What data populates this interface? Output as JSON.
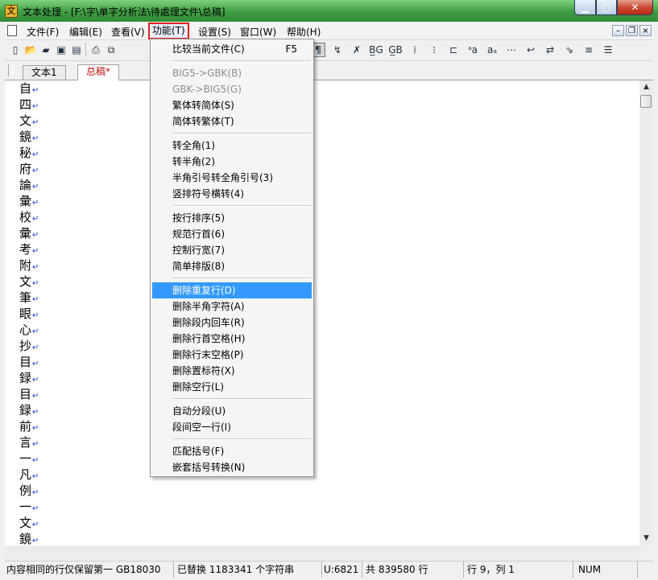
{
  "window": {
    "title": "文本处理 - [F:\\字\\单字分析法\\待處理文件\\总稿]",
    "icon": "app-icon",
    "min_glyph": "▁",
    "max_glyph": "▢",
    "close_glyph": "✕"
  },
  "menubar": {
    "items": [
      "文件(F)",
      "编辑(E)",
      "查看(V)",
      "功能(T)",
      "设置(S)",
      "窗口(W)",
      "帮助(H)"
    ],
    "active_index": 3,
    "mdi_min": "–",
    "mdi_restore": "❐",
    "mdi_close": "×"
  },
  "toolbar": {
    "left_icons": [
      "new-icon",
      "open-icon",
      "open-folder-icon",
      "save-icon",
      "save-all-icon",
      "print-icon",
      "copy-icon"
    ],
    "left_glyphs": [
      "▯",
      "📂",
      "▰",
      "▣",
      "▤",
      "⎙",
      "⧉"
    ],
    "right_icons": [
      "paragraph-icon",
      "wrap-icon",
      "clear-icon",
      "big5-gbk-icon",
      "gbk-big5-icon",
      "fullwidth-icon",
      "halfwidth-icon",
      "indent-icon",
      "case-up-icon",
      "case-down-icon",
      "grid-icon",
      "return-icon",
      "swap-icon",
      "sort-icon",
      "color-lines-icon",
      "align-icon"
    ],
    "right_glyphs": [
      "¶",
      "↯",
      "✗",
      "B̲G",
      "G̲B",
      "⁞",
      "⁝",
      "⊏",
      "ᵃa",
      "aₐ",
      "⋯",
      "↩",
      "⇄",
      "⇘",
      "≡",
      "☰"
    ]
  },
  "tabs": [
    {
      "label": "文本1",
      "active": false
    },
    {
      "label": "总稿*",
      "active": true
    }
  ],
  "editor": {
    "lines": [
      "自",
      "四",
      "文",
      "鏡",
      "秘",
      "府",
      "論",
      "彙",
      "校",
      "彙",
      "考",
      "附",
      "文",
      "筆",
      "眼",
      "心",
      "抄",
      "目",
      "録",
      "目",
      "録",
      "前",
      "言",
      "一",
      "凡",
      "例",
      "一",
      "文",
      "鏡"
    ],
    "return_mark": "↵"
  },
  "scroll": {
    "up": "▲",
    "down": "▼"
  },
  "statusbar": {
    "message": "内容相同的行仅保留第一",
    "encoding": "GB18030",
    "replaced": "已替换 1183341 个字符串",
    "unicode": "U:6821",
    "total_lines": "共 839580 行",
    "position": "行 9，列 1",
    "num": "NUM"
  },
  "dropdown": {
    "groups": [
      [
        {
          "label": "比较当前文件(C)",
          "shortcut": "F5"
        }
      ],
      [
        {
          "label": "BIG5->GBK(B)",
          "disabled": true
        },
        {
          "label": "GBK->BIG5(G)",
          "disabled": true
        },
        {
          "label": "繁体转简体(S)"
        },
        {
          "label": "简体转繁体(T)"
        }
      ],
      [
        {
          "label": "转全角(1)"
        },
        {
          "label": "转半角(2)"
        },
        {
          "label": "半角引号转全角引号(3)"
        },
        {
          "label": "竖排符号横转(4)"
        }
      ],
      [
        {
          "label": "按行排序(5)"
        },
        {
          "label": "规范行首(6)"
        },
        {
          "label": "控制行宽(7)"
        },
        {
          "label": "简单排版(8)"
        }
      ],
      [
        {
          "label": "删除重复行(D)",
          "highlighted": true
        },
        {
          "label": "删除半角字符(A)"
        },
        {
          "label": "删除段内回车(R)"
        },
        {
          "label": "删除行首空格(H)"
        },
        {
          "label": "删除行末空格(P)"
        },
        {
          "label": "删除置标符(X)"
        },
        {
          "label": "删除空行(L)"
        }
      ],
      [
        {
          "label": "自动分段(U)"
        },
        {
          "label": "段间空一行(I)"
        }
      ],
      [
        {
          "label": "匹配括号(F)"
        },
        {
          "label": "嵌套括号转换(N)"
        }
      ]
    ]
  }
}
